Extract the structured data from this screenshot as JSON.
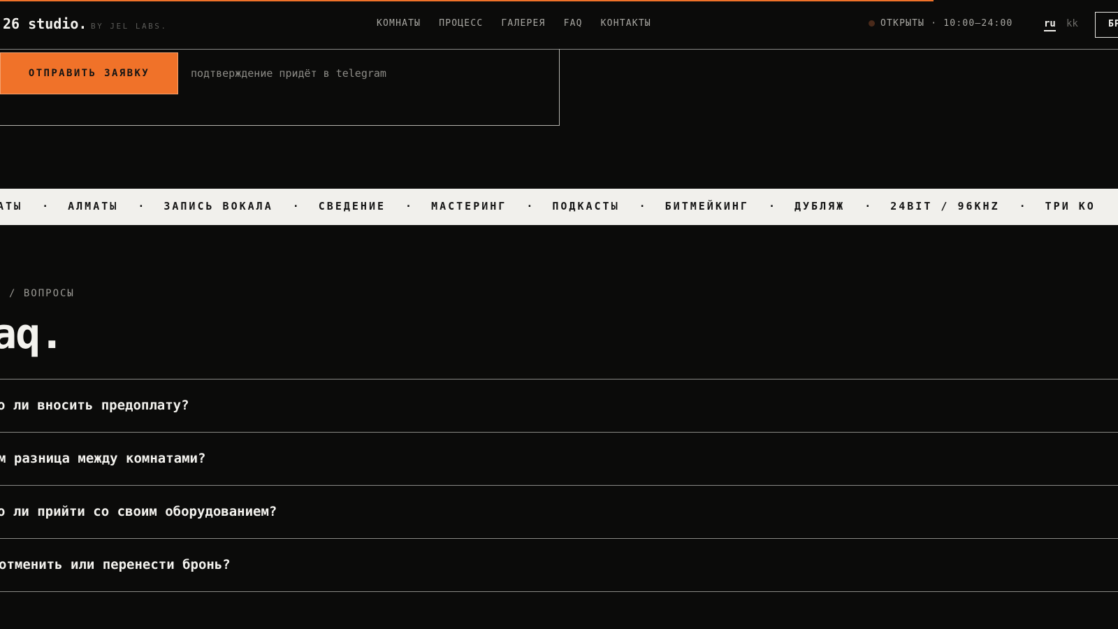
{
  "header": {
    "logo": "26 studio.",
    "logo_sub": "BY JEL LABS.",
    "nav": [
      "КОМНАТЫ",
      "ПРОЦЕСС",
      "ГАЛЕРЕЯ",
      "FAQ",
      "КОНТАКТЫ"
    ],
    "status": "ОТКРЫТЫ · 10:00–24:00",
    "lang_ru": "ru",
    "lang_kk": "kk",
    "book_label": "БРОНЬ"
  },
  "form": {
    "submit_label": "ОТПРАВИТЬ ЗАЯВКУ",
    "note": "подтверждение придёт в telegram"
  },
  "marquee": [
    "АТЫ",
    "АЛМАТЫ",
    "ЗАПИСЬ ВОКАЛА",
    "СВЕДЕНИЕ",
    "МАСТЕРИНГ",
    "ПОДКАСТЫ",
    "БИТМЕЙКИНГ",
    "ДУБЛЯЖ",
    "24BIT / 96KHZ",
    "ТРИ КО"
  ],
  "faq": {
    "crumb": "/ ВОПРОСЫ",
    "title": "aq.",
    "questions": [
      "о ли вносить предоплату?",
      "м разница между комнатами?",
      "о ли прийти со своим оборудованием?",
      "отменить или перенести бронь?"
    ]
  },
  "colors": {
    "accent": "#f07229",
    "background": "#0b0b0a",
    "marquee_bg": "#f1f0ec"
  },
  "scroll_progress": 0.835
}
